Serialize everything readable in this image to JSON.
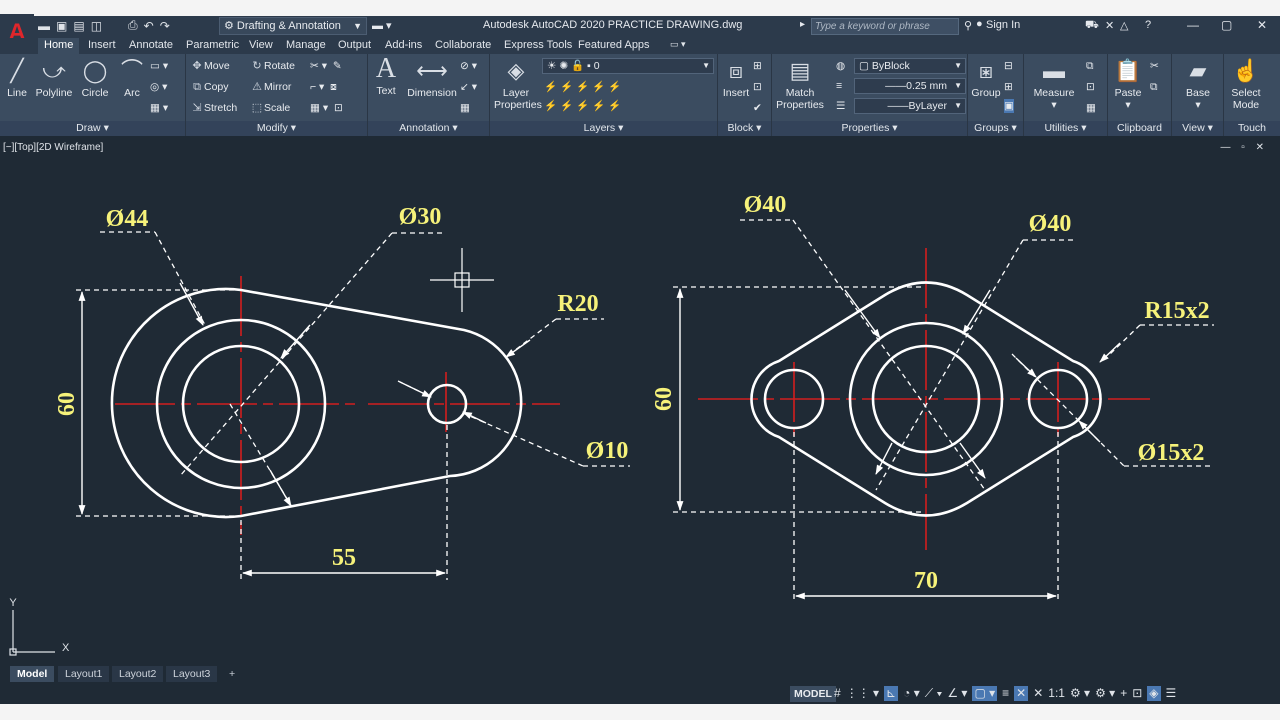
{
  "app": {
    "title": "Autodesk AutoCAD 2020    PRACTICE DRAWING.dwg",
    "logo": "A",
    "workspace": "Drafting & Annotation",
    "search_placeholder": "Type a keyword or phrase",
    "sign_in": "Sign In"
  },
  "tabs": [
    "Home",
    "Insert",
    "Annotate",
    "Parametric",
    "View",
    "Manage",
    "Output",
    "Add-ins",
    "Collaborate",
    "Express Tools",
    "Featured Apps"
  ],
  "ribbon": {
    "draw": {
      "title": "Draw",
      "line": "Line",
      "polyline": "Polyline",
      "circle": "Circle",
      "arc": "Arc"
    },
    "modify": {
      "title": "Modify",
      "move": "Move",
      "rotate": "Rotate",
      "copy": "Copy",
      "mirror": "Mirror",
      "stretch": "Stretch",
      "scale": "Scale"
    },
    "annotation": {
      "title": "Annotation",
      "text": "Text",
      "dimension": "Dimension"
    },
    "layers": {
      "title": "Layers",
      "layer_properties_1": "Layer",
      "layer_properties_2": "Properties",
      "current_layer": "0"
    },
    "block": {
      "title": "Block",
      "insert": "Insert"
    },
    "properties": {
      "title": "Properties",
      "match_1": "Match",
      "match_2": "Properties",
      "color": "ByBlock",
      "lineweight": "0.25 mm",
      "linetype": "ByLayer"
    },
    "groups": {
      "title": "Groups",
      "group": "Group"
    },
    "utilities": {
      "title": "Utilities",
      "measure": "Measure"
    },
    "clipboard": {
      "title": "Clipboard",
      "paste": "Paste"
    },
    "view": {
      "title": "View",
      "base": "Base"
    },
    "touch": {
      "title": "Touch",
      "select_1": "Select",
      "select_2": "Mode"
    }
  },
  "viewport": {
    "label": "[−][Top][2D Wireframe]",
    "ucs_x": "X",
    "ucs_y": "Y"
  },
  "dims": {
    "d44": "Ø44",
    "d30": "Ø30",
    "r20": "R20",
    "d10": "Ø10",
    "h60_left": "60",
    "l55": "55",
    "d40_a": "Ø40",
    "d40_b": "Ø40",
    "r15x2": "R15x2",
    "d15x2": "Ø15x2",
    "h60_right": "60",
    "l70": "70"
  },
  "layouts": [
    "Model",
    "Layout1",
    "Layout2",
    "Layout3",
    "+"
  ],
  "status": {
    "model": "MODEL",
    "scale": "1:1"
  }
}
